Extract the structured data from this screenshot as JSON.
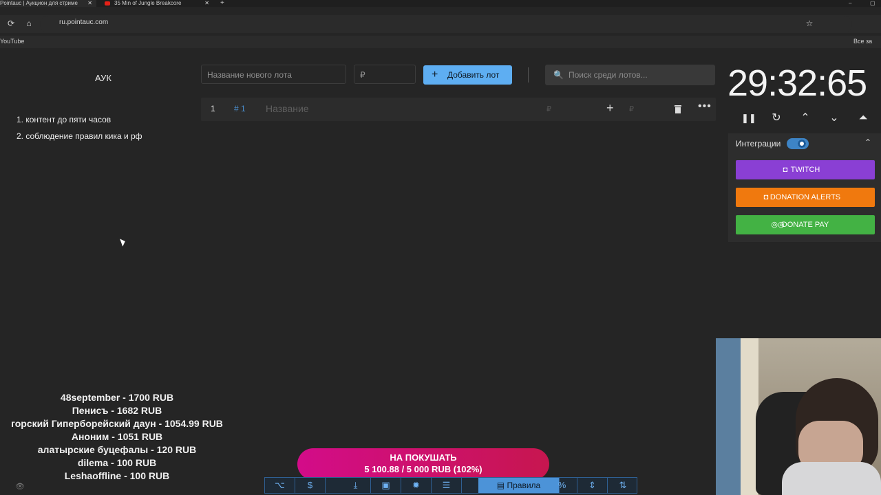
{
  "browser": {
    "tabs": [
      {
        "label": "Pointauc | Аукцион для стриме",
        "close": "✕"
      },
      {
        "label": "35 Min of Jungle Breakcore",
        "close": "✕"
      }
    ],
    "new_tab": "+",
    "url": "ru.pointauc.com",
    "bookmarks": {
      "youtube": "YouTube",
      "all": "Все за"
    },
    "icons": {
      "reload": "⟳",
      "home": "⌂",
      "star": "☆",
      "minimize": "–",
      "restore": "▢"
    }
  },
  "left_panel": {
    "title": "АУК",
    "rules": [
      "1. контент до пяти часов",
      "2. соблюдение правил кика и рф"
    ]
  },
  "controls": {
    "lot_name_placeholder": "Название нового лота",
    "amount_placeholder": "₽",
    "add_button_icon": "+",
    "add_button_label": "Добавить лот",
    "search_icon": "🔍",
    "search_placeholder": "Поиск среди лотов..."
  },
  "lot": {
    "number": "1",
    "id": "# 1",
    "name_placeholder": "Название",
    "amount_placeholder": "₽",
    "add_amount_icon": "+",
    "add_amount_placeholder": "₽",
    "more_icon": "•••"
  },
  "timer": {
    "value": "29:32:65",
    "controls": {
      "pause": "❚❚",
      "reset": "↻",
      "up": "⌃",
      "down": "⌄",
      "top": "⏶"
    }
  },
  "integrations": {
    "title": "Интеграции",
    "enabled": true,
    "collapse_icon": "⌃",
    "buttons": [
      {
        "label": "TWITCH",
        "icon": "◘"
      },
      {
        "label": "DONATION ALERTS",
        "icon": "◘"
      },
      {
        "label": "DONATE PAY",
        "icon": "◎◎"
      }
    ]
  },
  "donors": [
    "48september - 1700 RUB",
    "Пенисъ - 1682 RUB",
    "горский Гиперборейский даун - 1054.99 RUB",
    "Аноним - 1051 RUB",
    "алатырские буцефалы - 120 RUB",
    "dilema - 100 RUB",
    "Leshaoffline - 100 RUB"
  ],
  "eye_icon": "👁",
  "goal": {
    "title": "НА ПОКУШАТЬ",
    "progress": "5 100.88 / 5 000 RUB (102%)"
  },
  "toolbar": {
    "github": "⌥",
    "dollar": "$",
    "download": "⤓",
    "save": "▣",
    "bug": "✹",
    "list": "☰",
    "rules_icon": "▤",
    "rules_label": "Правила",
    "percent": "%",
    "split": "⇕",
    "sort": "⇅"
  }
}
